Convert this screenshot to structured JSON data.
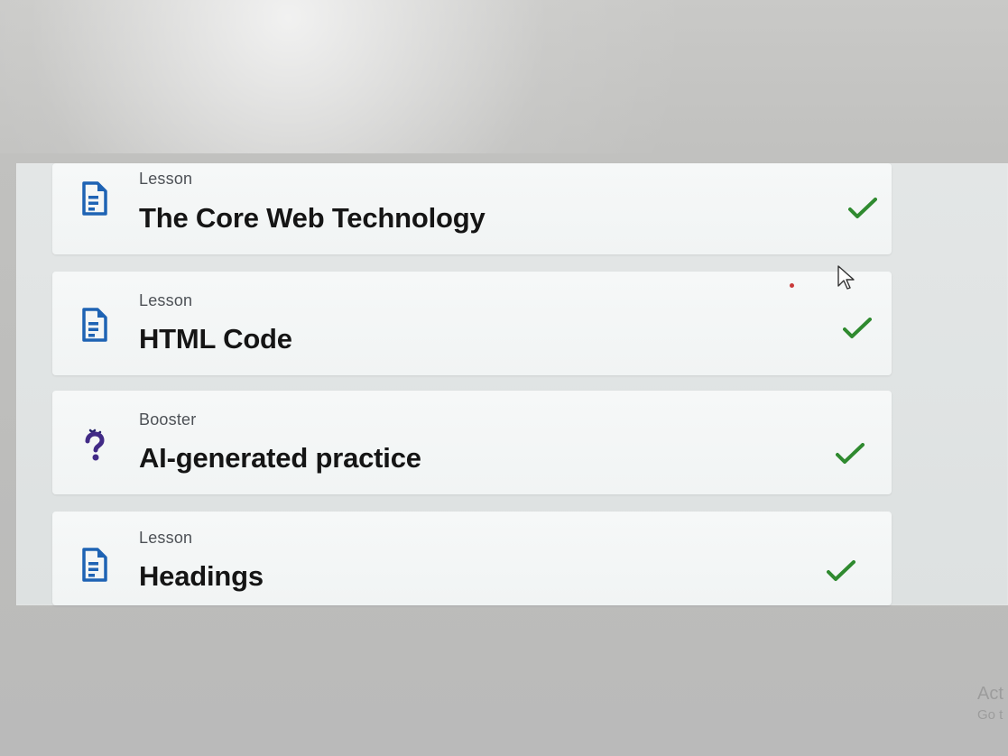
{
  "lessons": [
    {
      "type": "Lesson",
      "title": "The Core Web Technology",
      "icon": "document-icon",
      "status": "completed",
      "check_color": "#2f8a2f"
    },
    {
      "type": "Lesson",
      "title": "HTML Code",
      "icon": "document-icon",
      "status": "completed",
      "check_color": "#2f8a2f"
    },
    {
      "type": "Booster",
      "title": "AI-generated practice",
      "icon": "question-icon",
      "status": "completed",
      "check_color": "#2f8a2f"
    },
    {
      "type": "Lesson",
      "title": "Headings",
      "icon": "document-icon",
      "status": "completed",
      "check_color": "#2f8a2f"
    }
  ],
  "watermark": {
    "line1": "Act",
    "line2": "Go t"
  }
}
